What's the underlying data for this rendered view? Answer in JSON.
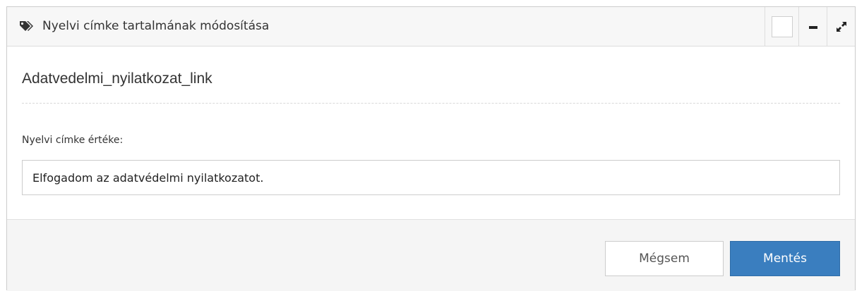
{
  "header": {
    "icon": "tags-icon",
    "title": "Nyelvi címke tartalmának módosítása",
    "tools": [
      "checkbox",
      "minimize-icon",
      "expand-icon"
    ]
  },
  "body": {
    "label_key": "Adatvedelmi_nyilatkozat_link",
    "field_label": "Nyelvi címke értéke:",
    "field_value": "Elfogadom az adatvédelmi nyilatkozatot."
  },
  "footer": {
    "cancel_label": "Mégsem",
    "save_label": "Mentés"
  },
  "colors": {
    "primary_button": "#3a7ebf",
    "header_background": "#f7f7f7",
    "footer_background": "#f5f5f5"
  }
}
